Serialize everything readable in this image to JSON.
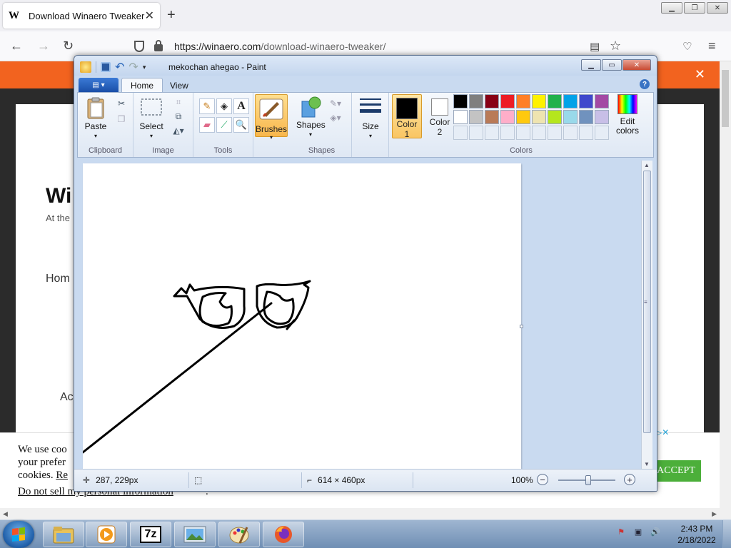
{
  "browser": {
    "tab_title": "Download Winaero Tweaker",
    "tab_favicon": "W",
    "url_host": "https://winaero.com",
    "url_path": "/download-winaero-tweaker/",
    "icons": [
      "back-arrow-icon",
      "forward-arrow-icon",
      "reload-icon",
      "shield-icon",
      "lock-icon",
      "reader-view-icon",
      "star-icon",
      "pocket-icon",
      "menu-icon"
    ]
  },
  "page": {
    "heading": "Wi",
    "subtitle": "At the",
    "nav_home": "Hom",
    "ad_text": "Ac",
    "cookie_line1": "We use coo",
    "cookie_line2": "your prefer",
    "cookie_line3": "cookies.",
    "cookie_link": "Re",
    "sell_link": "Do not sell my personal information",
    "sell_period": ".",
    "accept_label": "ACCEPT",
    "close_symbol": "✕",
    "ad_close": "▷✕"
  },
  "paint": {
    "title": "mekochan ahegao - Paint",
    "tabs": [
      "Home",
      "View"
    ],
    "groups": {
      "clipboard": "Clipboard",
      "image": "Image",
      "tools": "Tools",
      "shapes": "Shapes",
      "colors": "Colors"
    },
    "buttons": {
      "paste": "Paste",
      "select": "Select",
      "brushes": "Brushes",
      "shapes": "Shapes",
      "size": "Size",
      "color1_a": "Color",
      "color1_b": "1",
      "color2_a": "Color",
      "color2_b": "2",
      "edit_colors_a": "Edit",
      "edit_colors_b": "colors"
    },
    "color1": "#000000",
    "color2": "#ffffff",
    "palette_row1": [
      "#000000",
      "#7f7f7f",
      "#880015",
      "#ed1c24",
      "#ff7f27",
      "#fff200",
      "#22b14c",
      "#00a2e8",
      "#3f48cc",
      "#a349a4"
    ],
    "palette_row2": [
      "#ffffff",
      "#c3c3c3",
      "#b97a57",
      "#ffaec9",
      "#ffc90e",
      "#efe4b0",
      "#b5e61d",
      "#99d9ea",
      "#7092be",
      "#c8bfe7"
    ],
    "status": {
      "cursor_pos": "287, 229px",
      "image_size": "614 × 460px",
      "zoom": "100%"
    }
  },
  "taskbar": {
    "time": "2:43 PM",
    "date": "2/18/2022",
    "apps": [
      "file-explorer",
      "media-player",
      "7zip",
      "photo-viewer",
      "paint",
      "firefox"
    ],
    "sevenzip_label": "7z"
  }
}
